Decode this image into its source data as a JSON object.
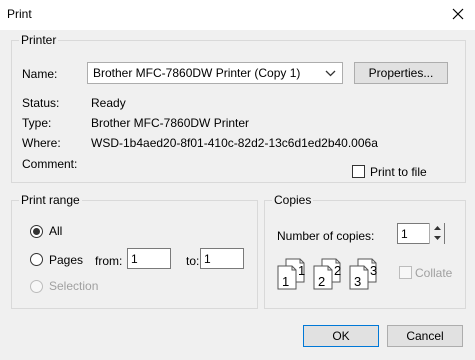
{
  "window": {
    "title": "Print",
    "close_glyph": "✕"
  },
  "printer": {
    "group_label": "Printer",
    "name_label": "Name:",
    "name_value": "Brother MFC-7860DW Printer (Copy 1)",
    "properties_label": "Properties...",
    "status_label": "Status:",
    "status_value": "Ready",
    "type_label": "Type:",
    "type_value": "Brother MFC-7860DW Printer",
    "where_label": "Where:",
    "where_value": "WSD-1b4aed20-8f01-410c-82d2-13c6d1ed2b40.006a",
    "comment_label": "Comment:",
    "print_to_file_label": "Print to file"
  },
  "print_range": {
    "group_label": "Print range",
    "all_label": "All",
    "pages_label": "Pages",
    "from_label": "from:",
    "from_value": "1",
    "to_label": "to:",
    "to_value": "1",
    "selection_label": "Selection"
  },
  "copies": {
    "group_label": "Copies",
    "number_label": "Number of copies:",
    "number_value": "1",
    "collate_label": "Collate",
    "collate_pages": [
      {
        "back": "1",
        "front": "1"
      },
      {
        "back": "2",
        "front": "2"
      },
      {
        "back": "3",
        "front": "3"
      }
    ]
  },
  "buttons": {
    "ok": "OK",
    "cancel": "Cancel"
  }
}
